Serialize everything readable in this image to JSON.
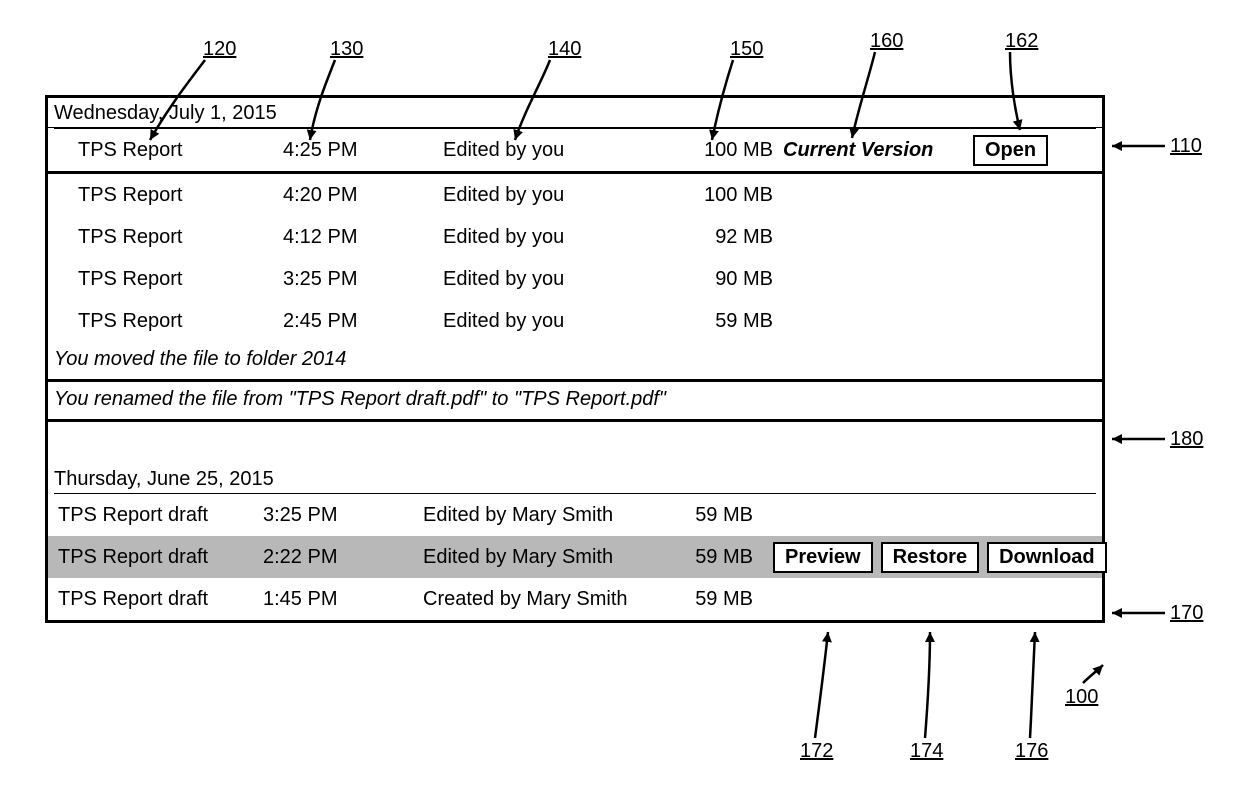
{
  "sections": [
    {
      "date": "Wednesday, July 1, 2015",
      "rows": [
        {
          "name": "TPS Report",
          "time": "4:25 PM",
          "editor": "Edited by you",
          "size": "100 MB",
          "tag": "Current Version",
          "actions": [
            "Open"
          ],
          "current": true
        },
        {
          "name": "TPS Report",
          "time": "4:20 PM",
          "editor": "Edited by you",
          "size": "100 MB"
        },
        {
          "name": "TPS Report",
          "time": "4:12 PM",
          "editor": "Edited by you",
          "size": "92 MB"
        },
        {
          "name": "TPS Report",
          "time": "3:25 PM",
          "editor": "Edited by you",
          "size": "90 MB"
        },
        {
          "name": "TPS Report",
          "time": "2:45 PM",
          "editor": "Edited by you",
          "size": "59 MB"
        }
      ],
      "events": [
        "You moved the file to folder 2014"
      ]
    },
    {
      "date": "Thursday, June 25, 2015",
      "preEvents": [
        "You renamed the file from \"TPS Report draft.pdf\" to \"TPS Report.pdf\""
      ],
      "rows": [
        {
          "name": "TPS Report draft",
          "time": "3:25 PM",
          "editor": "Edited by Mary Smith",
          "size": "59 MB"
        },
        {
          "name": "TPS Report draft",
          "time": "2:22 PM",
          "editor": "Edited by Mary Smith",
          "size": "59 MB",
          "actions": [
            "Preview",
            "Restore",
            "Download"
          ],
          "selected": true
        },
        {
          "name": "TPS Report draft",
          "time": "1:45 PM",
          "editor": "Created by Mary Smith",
          "size": "59 MB"
        }
      ]
    }
  ],
  "buttons": {
    "open": "Open",
    "preview": "Preview",
    "restore": "Restore",
    "download": "Download"
  },
  "refs": {
    "r100": "100",
    "r110": "110",
    "r120": "120",
    "r130": "130",
    "r140": "140",
    "r150": "150",
    "r160": "160",
    "r162": "162",
    "r170": "170",
    "r172": "172",
    "r174": "174",
    "r176": "176",
    "r180": "180"
  }
}
